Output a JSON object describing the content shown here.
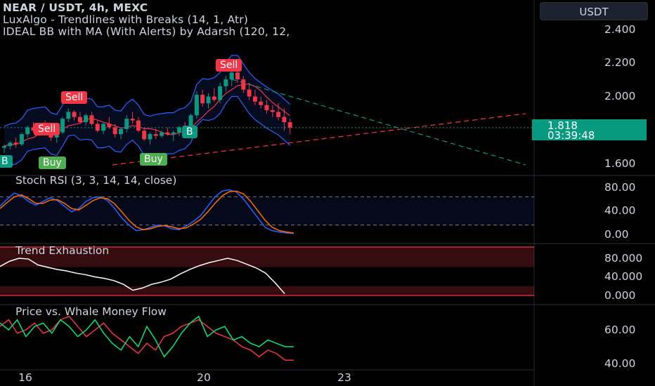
{
  "header": {
    "symbol_line": "NEAR / USDT, 4h, MEXC",
    "indicator1": "LuxAlgo - Trendlines with Breaks (14, 1, Atr)",
    "indicator2": "IDEAL BB with MA (With Alerts) by Adarsh (120, 12,"
  },
  "currency_button": "USDT",
  "price_badge": {
    "price": "1.818",
    "countdown": "03:39:48",
    "color": "#089981"
  },
  "panels": {
    "stoch": {
      "title": "Stoch RSI (3, 3, 14, 14, close)",
      "ticks": [
        "80.00",
        "40.00",
        "0.00"
      ]
    },
    "trend": {
      "title": "Trend Exhaustion",
      "ticks": [
        "80.000",
        "40.000",
        "0.000"
      ]
    },
    "whale": {
      "title": "Price vs. Whale Money Flow",
      "ticks": [
        "60.00",
        "40.00"
      ]
    }
  },
  "main_ticks": [
    "2.400",
    "2.200",
    "2.000",
    "1.600"
  ],
  "x_ticks": [
    "16",
    "20",
    "23"
  ],
  "signals": [
    {
      "label": "Sell",
      "kind": "sell"
    },
    {
      "label": "Sell",
      "kind": "sell"
    },
    {
      "label": "Sell",
      "kind": "sell"
    },
    {
      "label": "B",
      "kind": "buy"
    },
    {
      "label": "B",
      "kind": "buy"
    },
    {
      "label": "Buy",
      "kind": "buyg"
    },
    {
      "label": "Buy",
      "kind": "buyg"
    }
  ],
  "colors": {
    "up": "#089981",
    "down": "#f23645",
    "stoch_k": "#2962ff",
    "stoch_d": "#ff6d00",
    "whale_price": "#f23645",
    "whale_flow": "#00e676"
  },
  "chart_data": {
    "type": "candlestick",
    "y_range": [
      1.55,
      2.45
    ],
    "candles": [
      [
        1.7,
        1.72,
        1.67,
        1.71
      ],
      [
        1.71,
        1.74,
        1.69,
        1.73
      ],
      [
        1.73,
        1.76,
        1.7,
        1.72
      ],
      [
        1.72,
        1.79,
        1.71,
        1.78
      ],
      [
        1.78,
        1.83,
        1.76,
        1.82
      ],
      [
        1.82,
        1.85,
        1.79,
        1.8
      ],
      [
        1.8,
        1.84,
        1.77,
        1.83
      ],
      [
        1.83,
        1.86,
        1.8,
        1.81
      ],
      [
        1.81,
        1.83,
        1.74,
        1.76
      ],
      [
        1.76,
        1.8,
        1.73,
        1.79
      ],
      [
        1.79,
        1.88,
        1.78,
        1.87
      ],
      [
        1.87,
        1.93,
        1.85,
        1.91
      ],
      [
        1.91,
        1.92,
        1.86,
        1.88
      ],
      [
        1.88,
        1.91,
        1.84,
        1.85
      ],
      [
        1.85,
        1.9,
        1.83,
        1.89
      ],
      [
        1.89,
        1.91,
        1.83,
        1.84
      ],
      [
        1.84,
        1.86,
        1.79,
        1.8
      ],
      [
        1.8,
        1.85,
        1.78,
        1.84
      ],
      [
        1.84,
        1.88,
        1.81,
        1.82
      ],
      [
        1.82,
        1.84,
        1.76,
        1.78
      ],
      [
        1.78,
        1.82,
        1.75,
        1.81
      ],
      [
        1.81,
        1.89,
        1.79,
        1.87
      ],
      [
        1.87,
        1.91,
        1.84,
        1.86
      ],
      [
        1.86,
        1.88,
        1.79,
        1.8
      ],
      [
        1.8,
        1.82,
        1.74,
        1.75
      ],
      [
        1.75,
        1.79,
        1.72,
        1.78
      ],
      [
        1.78,
        1.81,
        1.75,
        1.77
      ],
      [
        1.77,
        1.8,
        1.76,
        1.79
      ],
      [
        1.79,
        1.82,
        1.77,
        1.78
      ],
      [
        1.78,
        1.8,
        1.74,
        1.79
      ],
      [
        1.79,
        1.83,
        1.77,
        1.82
      ],
      [
        1.82,
        1.85,
        1.8,
        1.81
      ],
      [
        1.81,
        1.9,
        1.8,
        1.89
      ],
      [
        1.89,
        2.03,
        1.87,
        2.01
      ],
      [
        2.01,
        2.04,
        1.94,
        1.96
      ],
      [
        1.96,
        2.02,
        1.93,
        2.0
      ],
      [
        2.0,
        2.05,
        1.97,
        1.98
      ],
      [
        1.98,
        2.08,
        1.96,
        2.06
      ],
      [
        2.06,
        2.12,
        2.03,
        2.1
      ],
      [
        2.1,
        2.16,
        2.06,
        2.14
      ],
      [
        2.14,
        2.17,
        2.08,
        2.1
      ],
      [
        2.1,
        2.12,
        2.02,
        2.04
      ],
      [
        2.04,
        2.08,
        1.98,
        2.0
      ],
      [
        2.0,
        2.04,
        1.95,
        1.97
      ],
      [
        1.97,
        2.0,
        1.93,
        1.95
      ],
      [
        1.95,
        1.98,
        1.9,
        1.92
      ],
      [
        1.92,
        1.95,
        1.88,
        1.91
      ],
      [
        1.91,
        1.96,
        1.86,
        1.88
      ],
      [
        1.88,
        1.93,
        1.8,
        1.85
      ],
      [
        1.85,
        1.87,
        1.78,
        1.818
      ]
    ],
    "stoch_k": [
      60,
      75,
      88,
      82,
      70,
      62,
      70,
      78,
      72,
      60,
      48,
      55,
      70,
      78,
      80,
      72,
      55,
      35,
      20,
      8,
      10,
      15,
      20,
      18,
      12,
      10,
      18,
      28,
      40,
      60,
      80,
      92,
      95,
      90,
      75,
      55,
      35,
      15,
      8,
      5,
      3,
      2
    ],
    "stoch_d": [
      55,
      68,
      80,
      84,
      76,
      66,
      66,
      73,
      74,
      66,
      55,
      52,
      62,
      72,
      78,
      76,
      65,
      48,
      30,
      16,
      10,
      12,
      17,
      19,
      16,
      12,
      14,
      22,
      32,
      48,
      66,
      82,
      91,
      92,
      86,
      70,
      50,
      30,
      15,
      8,
      5,
      3
    ],
    "trend": [
      78,
      92,
      100,
      98,
      82,
      76,
      70,
      66,
      60,
      56,
      50,
      46,
      40,
      30,
      14,
      20,
      30,
      36,
      44,
      58,
      70,
      80,
      88,
      94,
      100,
      94,
      84,
      74,
      60,
      34,
      5
    ],
    "whale_price": [
      62,
      66,
      58,
      60,
      64,
      58,
      60,
      66,
      68,
      62,
      56,
      60,
      64,
      58,
      54,
      50,
      46,
      52,
      48,
      56,
      58,
      62,
      64,
      66,
      62,
      58,
      56,
      54,
      50,
      48,
      44,
      48,
      46,
      42,
      42
    ],
    "whale_flow": [
      64,
      60,
      66,
      56,
      62,
      64,
      58,
      66,
      62,
      56,
      60,
      66,
      58,
      52,
      48,
      56,
      50,
      62,
      54,
      44,
      50,
      58,
      64,
      68,
      56,
      60,
      62,
      54,
      56,
      52,
      50,
      54,
      52,
      50,
      50
    ]
  }
}
